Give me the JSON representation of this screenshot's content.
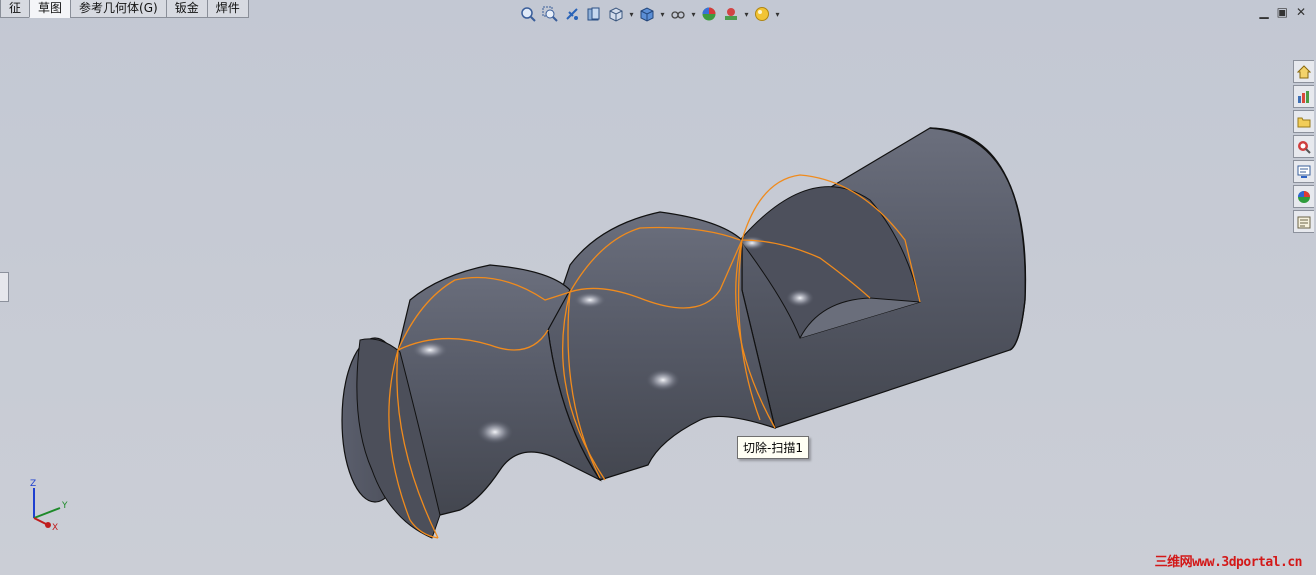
{
  "tabs": [
    {
      "label": "征"
    },
    {
      "label": "草图"
    },
    {
      "label": "参考几何体(G)"
    },
    {
      "label": "钣金"
    },
    {
      "label": "焊件"
    }
  ],
  "active_tab_index": 1,
  "toolbar_icons": [
    "zoom-to-fit-icon",
    "zoom-to-area-icon",
    "previous-view-icon",
    "section-view-icon",
    "view-orientation-icon",
    "display-style-icon",
    "hide-show-items-icon",
    "edit-appearance-icon",
    "apply-scene-icon",
    "view-settings-icon"
  ],
  "window_controls": {
    "minimize": "▁",
    "restore": "▣",
    "close": "✕"
  },
  "taskpane_icons": [
    "solidworks-resources-icon",
    "design-library-icon",
    "file-explorer-icon",
    "search-icon",
    "view-palette-icon",
    "appearances-icon",
    "custom-properties-icon"
  ],
  "tooltip": {
    "text": "切除-扫描1"
  },
  "triad": {
    "x": "X",
    "y": "Y",
    "z": "Z"
  },
  "watermark": {
    "text": "三维网www.3dportal.cn"
  },
  "colors": {
    "background": "#c5c9d3",
    "model": "#5a5e6b",
    "edge_highlight": "#f08b1d",
    "watermark": "#d31818"
  }
}
